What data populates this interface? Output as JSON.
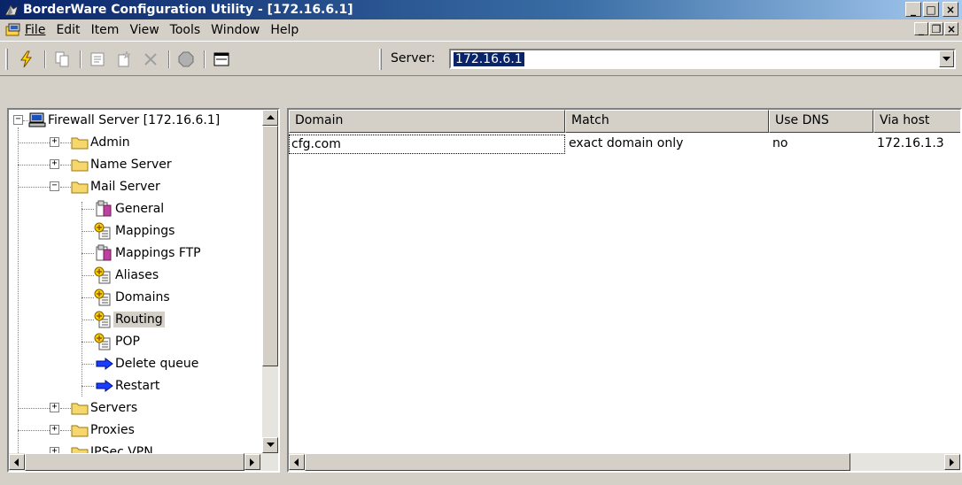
{
  "window": {
    "title": "BorderWare Configuration Utility - [172.16.6.1]",
    "minimize_symbol": "_",
    "maximize_symbol": "□",
    "close_symbol": "×"
  },
  "menu": {
    "items": [
      {
        "label": "File"
      },
      {
        "label": "Edit"
      },
      {
        "label": "Item"
      },
      {
        "label": "View"
      },
      {
        "label": "Tools"
      },
      {
        "label": "Window"
      },
      {
        "label": "Help"
      }
    ],
    "child_minimize_symbol": "_",
    "child_restore_symbol": "❐",
    "child_close_symbol": "×"
  },
  "toolbar": {
    "server_label": "Server:",
    "server_value": "172.16.6.1",
    "icons": [
      "connect-icon",
      "copy-icon",
      "properties-icon",
      "new-item-icon",
      "delete-icon",
      "stop-icon",
      "console-icon"
    ]
  },
  "tree": {
    "root_label": "Firewall Server [172.16.6.1]",
    "nodes": {
      "admin": "Admin",
      "name_server": "Name Server",
      "mail_server": "Mail Server",
      "general": "General",
      "mappings": "Mappings",
      "mappings_ftp": "Mappings FTP",
      "aliases": "Aliases",
      "domains": "Domains",
      "routing": "Routing",
      "pop": "POP",
      "delete_queue": "Delete queue",
      "restart": "Restart",
      "servers": "Servers",
      "proxies": "Proxies",
      "ipsec_vpn": "IPSec VPN"
    },
    "selected": "Routing"
  },
  "list": {
    "columns": [
      "Domain",
      "Match",
      "Use DNS",
      "Via host"
    ],
    "rows": [
      [
        "cfg.com",
        "exact domain only",
        "no",
        "172.16.1.3"
      ]
    ]
  },
  "colors": {
    "titlebar_start": "#0a246a",
    "titlebar_end": "#a6caf0",
    "selection": "#0a246a",
    "face": "#d4d0c8"
  }
}
